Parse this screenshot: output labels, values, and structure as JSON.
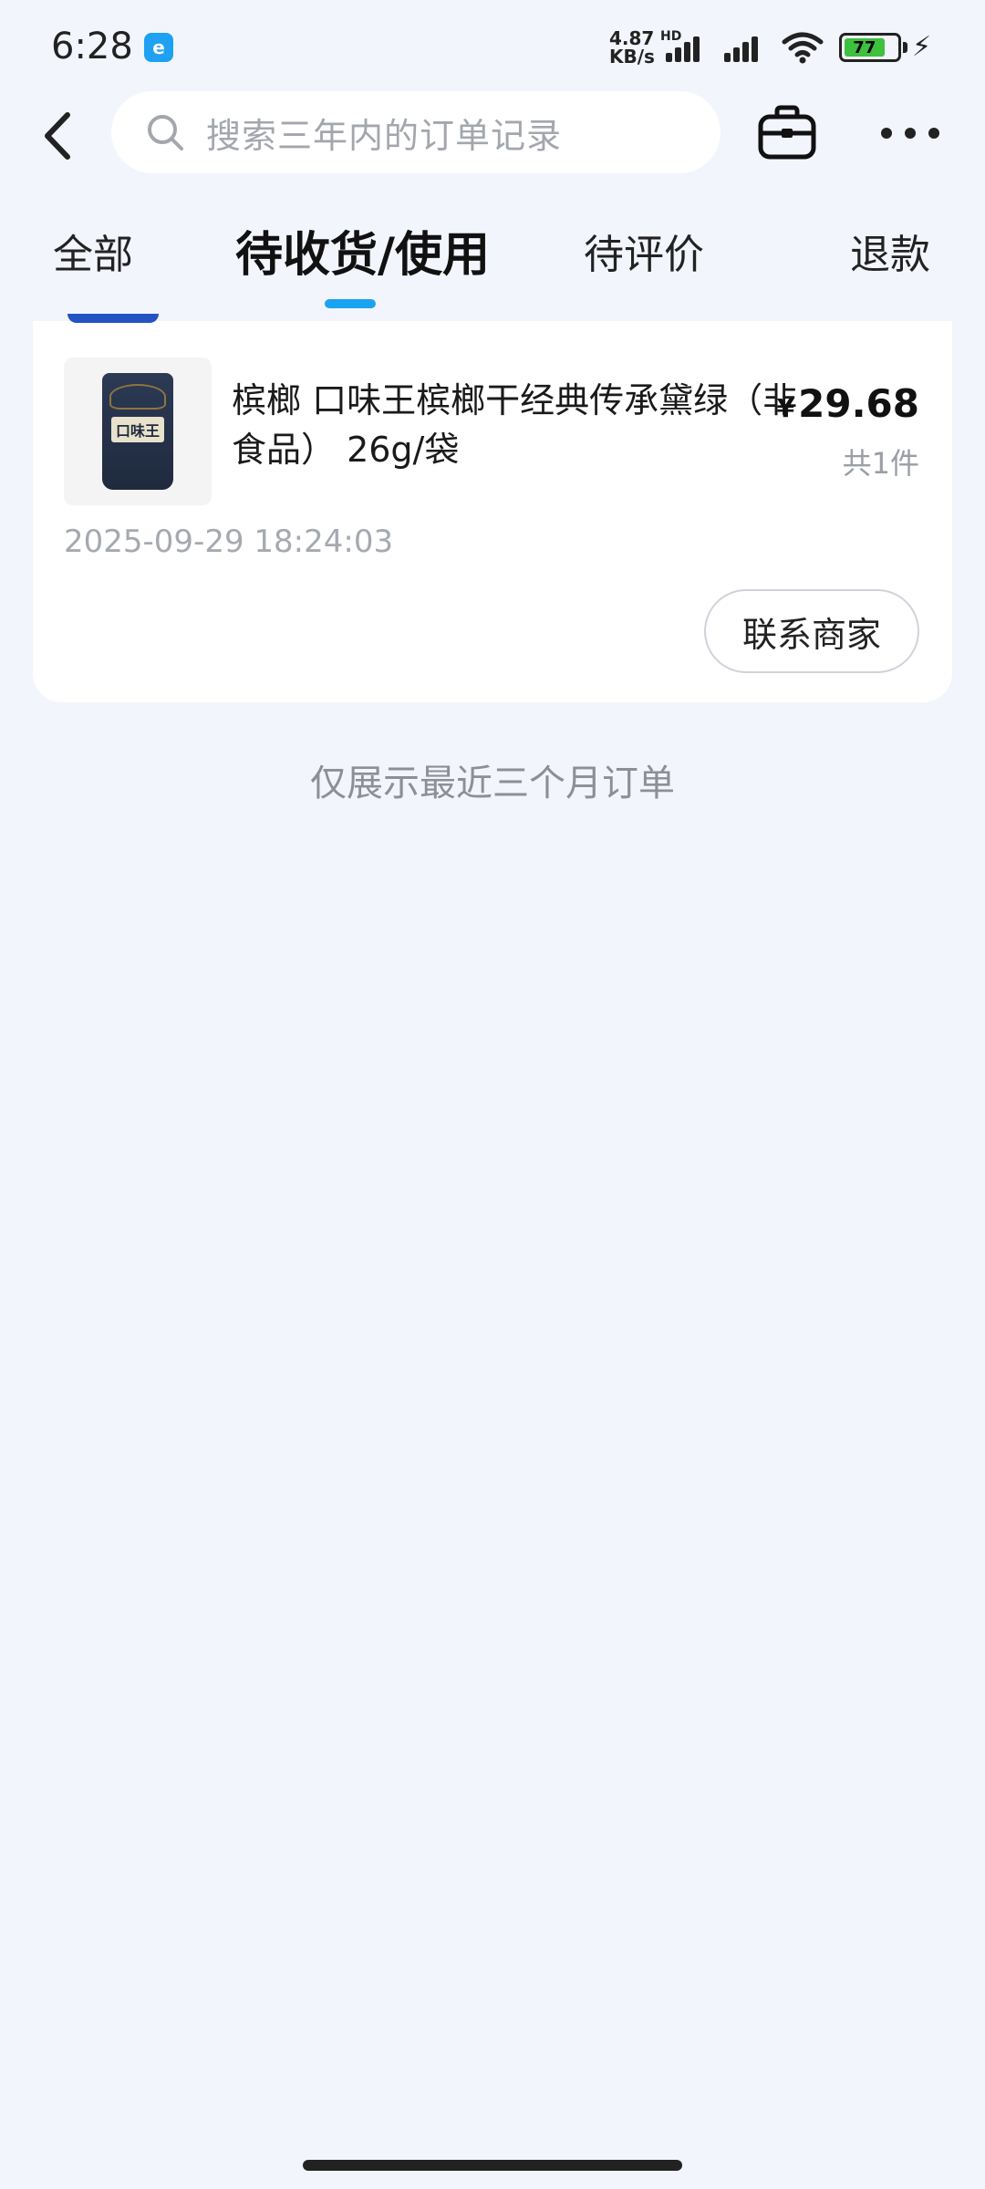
{
  "status_bar": {
    "time": "6:28",
    "network_speed_value": "4.87",
    "network_speed_unit": "KB/s",
    "hd_label": "HD",
    "battery_level": "77",
    "icons": [
      "app-notification-icon",
      "signal-icon",
      "signal-icon",
      "wifi-icon",
      "battery-icon",
      "charging-icon"
    ]
  },
  "header": {
    "search_placeholder": "搜索三年内的订单记录",
    "icons": [
      "back-arrow-icon",
      "search-icon",
      "toolbox-icon",
      "more-icon"
    ]
  },
  "tabs": [
    {
      "label": "全部",
      "active": false
    },
    {
      "label": "待收货/使用",
      "active": true
    },
    {
      "label": "待评价",
      "active": false
    },
    {
      "label": "退款",
      "active": false
    }
  ],
  "order": {
    "product_title": "槟榔 口味王槟榔干经典传承黛绿（非食品） 26g/袋",
    "thumbnail_label": "口味王",
    "currency_symbol": "¥",
    "price": "29.68",
    "quantity": "共1件",
    "order_time": "2025-09-29 18:24:03",
    "contact_button": "联系商家"
  },
  "notice": "仅展示最近三个月订单",
  "colors": {
    "background": "#f2f5fb",
    "accent": "#1aa3f0",
    "card": "#ffffff"
  }
}
